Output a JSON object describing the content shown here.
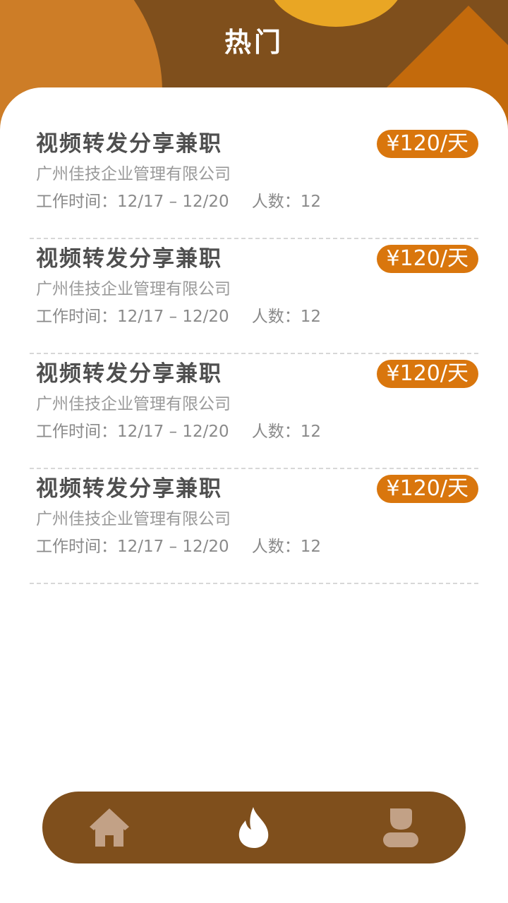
{
  "header": {
    "title": "热门"
  },
  "jobs": [
    {
      "title": "视频转发分享兼职",
      "salary": "¥120/天",
      "company": "广州佳技企业管理有限公司",
      "time": "工作时间：12/17 – 12/20",
      "count": "人数：12"
    },
    {
      "title": "视频转发分享兼职",
      "salary": "¥120/天",
      "company": "广州佳技企业管理有限公司",
      "time": "工作时间：12/17 – 12/20",
      "count": "人数：12"
    },
    {
      "title": "视频转发分享兼职",
      "salary": "¥120/天",
      "company": "广州佳技企业管理有限公司",
      "time": "工作时间：12/17 – 12/20",
      "count": "人数：12"
    },
    {
      "title": "视频转发分享兼职",
      "salary": "¥120/天",
      "company": "广州佳技企业管理有限公司",
      "time": "工作时间：12/17 – 12/20",
      "count": "人数：12"
    }
  ],
  "nav": {
    "items": [
      {
        "icon": "home-icon",
        "active": false
      },
      {
        "icon": "fire-icon",
        "active": true
      },
      {
        "icon": "user-icon",
        "active": false
      }
    ]
  },
  "colors": {
    "brand_brown": "#7f4f1c",
    "accent_orange": "#d9760d",
    "sun_yellow": "#e9a624",
    "inactive_icon": "#c2a186",
    "active_icon": "#ffffff"
  }
}
